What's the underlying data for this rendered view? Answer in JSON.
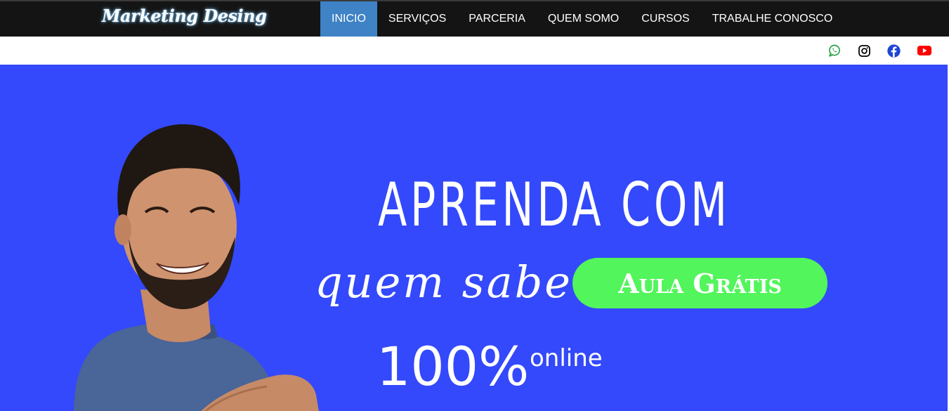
{
  "brand": {
    "name": "Marketing Desing"
  },
  "nav": {
    "items": [
      {
        "label": "INICIO",
        "active": true
      },
      {
        "label": "SERVIÇOS",
        "active": false
      },
      {
        "label": "PARCERIA",
        "active": false
      },
      {
        "label": "QUEM SOMO",
        "active": false
      },
      {
        "label": "CURSOS",
        "active": false
      },
      {
        "label": "TRABALHE CONOSCO",
        "active": false
      }
    ],
    "active_color": "#3f82c6",
    "bar_color": "#141414"
  },
  "social": {
    "icons": [
      {
        "name": "whatsapp-icon",
        "color": "#25a244"
      },
      {
        "name": "instagram-icon",
        "color": "#000000"
      },
      {
        "name": "facebook-icon",
        "color": "#1f45d6"
      },
      {
        "name": "youtube-icon",
        "color": "#ff0000"
      }
    ]
  },
  "hero": {
    "background": "#3349fb",
    "line1": "APRENDA COM",
    "line2": "quem sabe",
    "cta_label": "Aula Grátis",
    "cta_color": "#52f55b",
    "percent": "100%",
    "online": "online"
  }
}
